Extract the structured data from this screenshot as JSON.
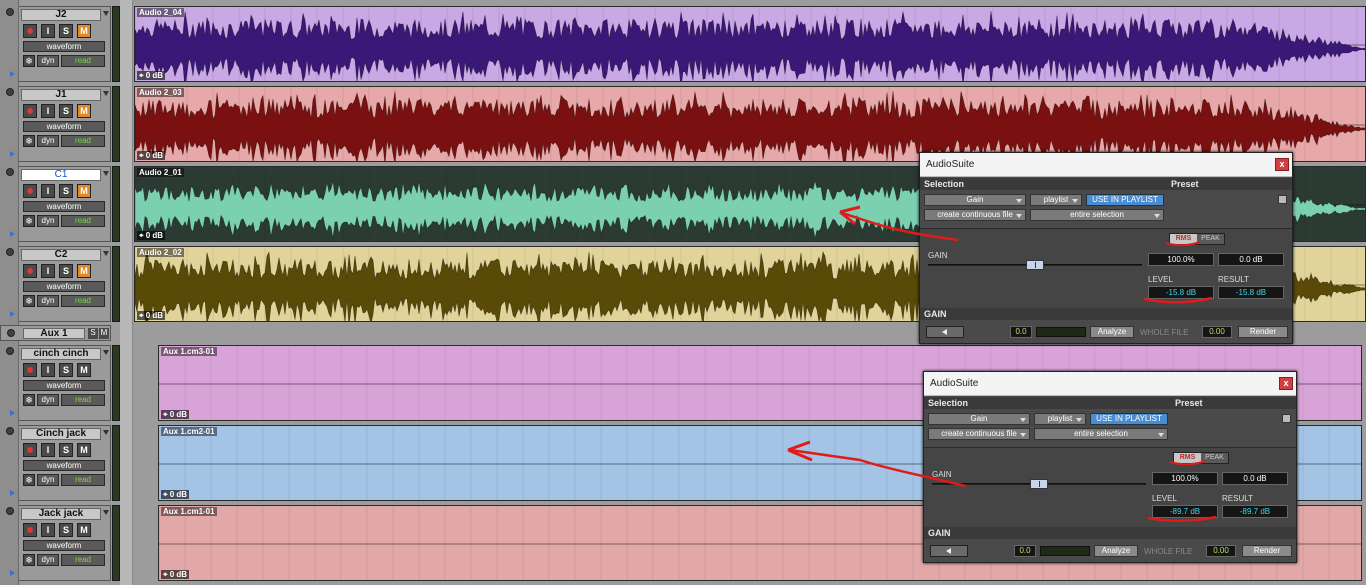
{
  "colors": {
    "accent_blue": "#4a8ccf",
    "mute_orange": "#e0892a",
    "annotation_red": "#e11a1a",
    "level_cyan": "#3ed8e6"
  },
  "tracks": [
    {
      "name": "J2",
      "view": "waveform",
      "auto_mode": "dyn",
      "auto_state": "read",
      "mute_active": true,
      "selected": false
    },
    {
      "name": "J1",
      "view": "waveform",
      "auto_mode": "dyn",
      "auto_state": "read",
      "mute_active": true,
      "selected": false
    },
    {
      "name": "C1",
      "view": "waveform",
      "auto_mode": "dyn",
      "auto_state": "read",
      "mute_active": true,
      "selected": true
    },
    {
      "name": "C2",
      "view": "waveform",
      "auto_mode": "dyn",
      "auto_state": "read",
      "mute_active": true,
      "selected": false
    },
    {
      "name": "cinch cinch",
      "view": "waveform",
      "auto_mode": "dyn",
      "auto_state": "read",
      "mute_active": false,
      "selected": false
    },
    {
      "name": "Cinch jack",
      "view": "waveform",
      "auto_mode": "dyn",
      "auto_state": "read",
      "mute_active": false,
      "selected": false
    },
    {
      "name": "Jack jack",
      "view": "waveform",
      "auto_mode": "dyn",
      "auto_state": "read",
      "mute_active": false,
      "selected": false
    }
  ],
  "track_buttons": {
    "input": "I",
    "solo": "S",
    "mute": "M"
  },
  "aux_folder": {
    "name": "Aux 1",
    "solo": "S",
    "mute": "M"
  },
  "clips": [
    {
      "name": "Audio 2_04",
      "gain": "0 dB",
      "color": "#c9a8e6",
      "wave_color": "#3a1878"
    },
    {
      "name": "Audio 2_03",
      "gain": "0 dB",
      "color": "#e6a8a8",
      "wave_color": "#7a1010"
    },
    {
      "name": "Audio 2_01",
      "gain": "0 dB",
      "color": "#2c3a34",
      "wave_color": "#7ad0b0"
    },
    {
      "name": "Audio 2_02",
      "gain": "0 dB",
      "color": "#e0d49a",
      "wave_color": "#5a4a08"
    },
    {
      "name": "Aux 1.cm3-01",
      "gain": "0 dB",
      "color": "#d8a4d8",
      "wave_color": ""
    },
    {
      "name": "Aux 1.cm2-01",
      "gain": "0 dB",
      "color": "#a4c4e6",
      "wave_color": ""
    },
    {
      "name": "Aux 1.cm1-01",
      "gain": "0 dB",
      "color": "#e2a8a8",
      "wave_color": ""
    }
  ],
  "audiosuite_windows": [
    {
      "title": "AudioSuite",
      "close": "x",
      "selection_label": "Selection",
      "preset_label": "Preset",
      "plugin": "Gain",
      "playlist": "playlist",
      "use_in_playlist": "USE IN PLAYLIST",
      "processing_mode": "create continuous file",
      "selection_mode": "entire selection",
      "rms": "RMS",
      "peak": "PEAK",
      "percent": "100.0%",
      "gain_db": "0.0 dB",
      "gain_label": "GAIN",
      "level_label": "LEVEL",
      "result_label": "RESULT",
      "level": "-15.8 dB",
      "result": "-15.8 dB",
      "section_gain": "GAIN",
      "handle_value": "0.0",
      "analyze": "Analyze",
      "whole_file": "WHOLE FILE",
      "handle_length": "0.00",
      "render": "Render"
    },
    {
      "title": "AudioSuite",
      "close": "x",
      "selection_label": "Selection",
      "preset_label": "Preset",
      "plugin": "Gain",
      "playlist": "playlist",
      "use_in_playlist": "USE IN PLAYLIST",
      "processing_mode": "create continuous file",
      "selection_mode": "entire selection",
      "rms": "RMS",
      "peak": "PEAK",
      "percent": "100.0%",
      "gain_db": "0.0 dB",
      "gain_label": "GAIN",
      "level_label": "LEVEL",
      "result_label": "RESULT",
      "level": "-89.7 dB",
      "result": "-89.7 dB",
      "section_gain": "GAIN",
      "handle_value": "0.0",
      "analyze": "Analyze",
      "whole_file": "WHOLE FILE",
      "handle_length": "0.00",
      "render": "Render"
    }
  ]
}
